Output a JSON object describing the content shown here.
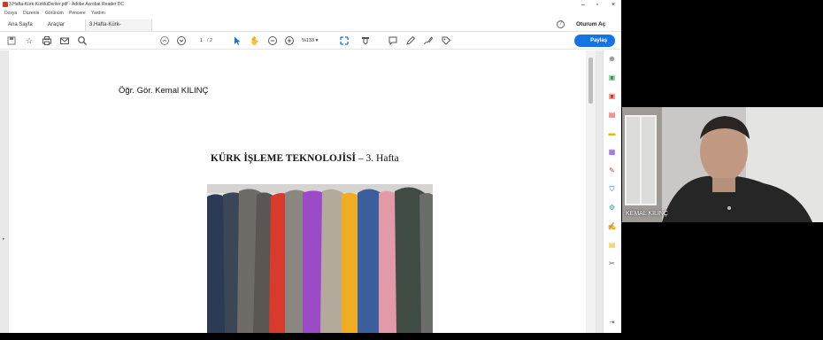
{
  "window": {
    "title": "3.Hafta-Kürk-KürklüDeriler.pdf - Adobe Acrobat Reader DC",
    "menu": [
      "Dosya",
      "Düzenle",
      "Görünüm",
      "Pencere",
      "Yardım"
    ]
  },
  "tabs": {
    "home": "Ana Sayfa",
    "tools": "Araçlar",
    "document": "3.Hafta-Kürk-Kürklü...",
    "close_symbol": "×"
  },
  "header": {
    "help_symbol": "?",
    "sign_in": "Oturum Aç"
  },
  "toolbar": {
    "page_current": "1",
    "page_total": "/ 2",
    "zoom": "%133"
  },
  "share": {
    "label": "Paylaş"
  },
  "document": {
    "author": "Öğr. Gör. Kemal KILINÇ",
    "title_bold": "KÜRK İŞLEME TEKNOLOJİSİ",
    "title_rest": " – 3. Hafta"
  },
  "webcam": {
    "participant_name": "KEMAL KILINÇ"
  },
  "colors": {
    "accent": "#1473e6",
    "acrobat_red": "#d9342b"
  }
}
